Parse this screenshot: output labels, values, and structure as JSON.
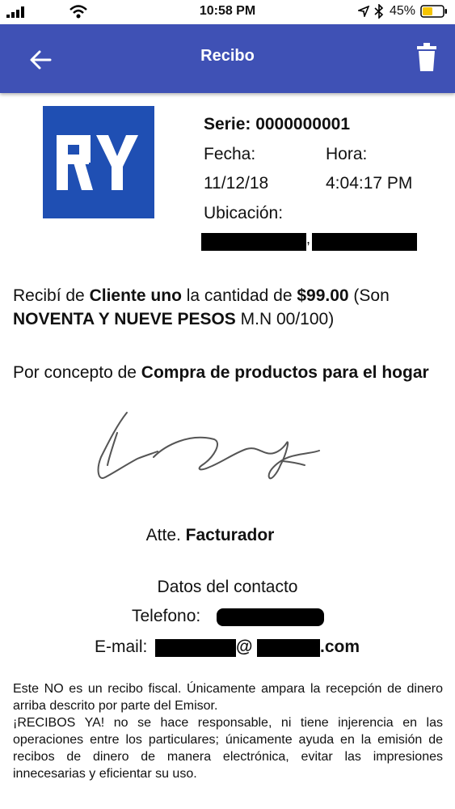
{
  "status_bar": {
    "time": "10:58 PM",
    "battery": "45%",
    "icons": [
      "signal-icon",
      "wifi-icon",
      "location-icon",
      "bluetooth-icon",
      "battery-icon"
    ]
  },
  "app_bar": {
    "title": "Recibo",
    "color": "#3f51b5",
    "back_icon": "arrow-left-icon",
    "delete_icon": "trash-icon"
  },
  "receipt": {
    "logo_text": "RY",
    "logo_color": "#1f4fb3",
    "serie": "Serie: 0000000001",
    "fecha_label": "Fecha:",
    "fecha_value": "11/12/18",
    "hora_label": "Hora:",
    "hora_value": "4:04:17 PM",
    "ubicacion_label": "Ubicación:",
    "received_prefix": "Recibí de ",
    "client": "Cliente uno",
    "received_mid": " la cantidad de ",
    "amount": "$99.00",
    "amount_open": " (Son ",
    "amount_words": "NOVENTA Y NUEVE PESOS",
    "amount_suffix": " M.N 00/100)",
    "concept_prefix": "Por concepto de ",
    "concept": "Compra de productos para el hogar",
    "atte_prefix": "Atte. ",
    "issuer": "Facturador"
  },
  "contact": {
    "title": "Datos del contacto",
    "phone_label": "Telefono:",
    "email_label": "E-mail:",
    "email_at": "@",
    "email_suffix": ".com"
  },
  "disclaimer": {
    "line1": "Este NO es un recibo fiscal. Únicamente ampara la recepción de dinero arriba descrito por parte del Emisor.",
    "line2": "¡RECIBOS YA! no se hace responsable, ni tiene injerencia en las operaciones entre los particulares; únicamente ayuda en la emisión de recibos de dinero de manera electrónica, evitar las impresiones innecesarias y eficientar su uso."
  }
}
